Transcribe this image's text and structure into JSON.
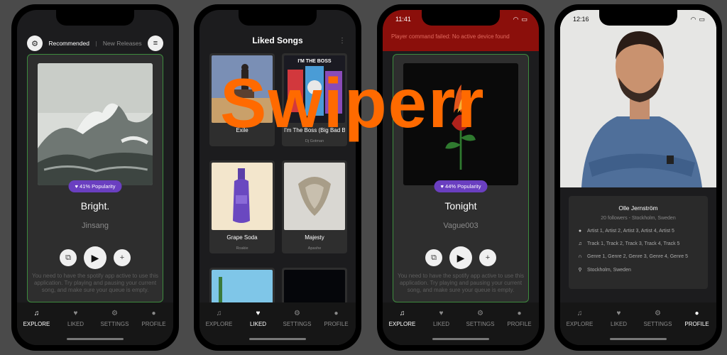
{
  "overlay": {
    "title": "Swiperr",
    "color": "#ff6a00"
  },
  "colors": {
    "accent_purple": "#6a3fc0",
    "card_border_green": "#3d8b3d",
    "error_red": "#8b0f0b"
  },
  "tabs": [
    {
      "label": "EXPLORE",
      "icon": "music-note-icon"
    },
    {
      "label": "LIKED",
      "icon": "heart-icon"
    },
    {
      "label": "SETTINGS",
      "icon": "gear-icon"
    },
    {
      "label": "PROFILE",
      "icon": "person-icon"
    }
  ],
  "explore": {
    "nav": {
      "recommended": "Recommended",
      "separator": "|",
      "new_releases": "New Releases"
    },
    "card": {
      "popularity": "41% Popularity",
      "title": "Bright.",
      "artist": "Jinsang",
      "note": "You need to have the spotify app active to use this application. Try playing and pausing your current song, and make sure your queue is empty."
    }
  },
  "liked": {
    "header": "Liked Songs",
    "items": [
      {
        "title": "Exile",
        "subtitle": ""
      },
      {
        "title": "I'm The Boss (Big Bad Bosses Remix)",
        "subtitle": "Dj Gotman"
      },
      {
        "title": "Grape Soda",
        "subtitle": "Roakie"
      },
      {
        "title": "Majesty",
        "subtitle": "Apashe"
      }
    ]
  },
  "error_screen": {
    "time": "11:41",
    "error": "Player command failed: No active device found",
    "card": {
      "popularity": "44% Popularity",
      "title": "Tonight",
      "artist": "Vague003",
      "note": "You need to have the spotify app active to use this application. Try playing and pausing your current song, and make sure your queue is empty."
    }
  },
  "profile": {
    "time": "12:16",
    "name": "Olle Jernström",
    "followers": "20 followers - Stockholm, Sweden",
    "artists": "Artist 1, Artist 2, Artist 3, Artist 4, Artist 5",
    "tracks": "Track 1, Track 2, Track 3, Track 4, Track 5",
    "genres": "Genre 1, Genre 2, Genre 3, Genre 4, Genre 5",
    "location": "Stockholm, Sweden"
  }
}
